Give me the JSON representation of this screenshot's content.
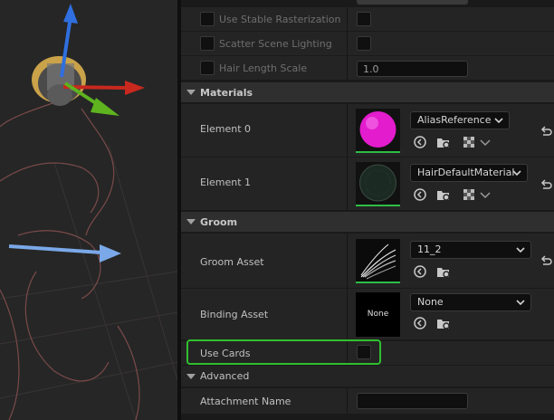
{
  "rendering": {
    "use_stable_rasterization": "Use Stable Rasterization",
    "scatter_scene_lighting": "Scatter Scene Lighting",
    "hair_length_scale": "Hair Length Scale",
    "hair_length_scale_value": "1.0"
  },
  "materials": {
    "title": "Materials",
    "elements": [
      {
        "label": "Element 0",
        "value": "AliasReference",
        "thumb_color": "#e31ccd"
      },
      {
        "label": "Element 1",
        "value": "HairDefaultMaterial",
        "thumb_color": "#1c2a24"
      }
    ]
  },
  "groom": {
    "title": "Groom",
    "groom_asset_label": "Groom Asset",
    "groom_asset_value": "11_2",
    "binding_asset_label": "Binding Asset",
    "binding_asset_value": "None",
    "binding_thumb_text": "None",
    "use_cards_label": "Use Cards"
  },
  "advanced": {
    "title": "Advanced",
    "attachment_name_label": "Attachment Name",
    "attachment_name_value": ""
  },
  "colors": {
    "accent_green": "#2fbf2f",
    "material0": "#e31ccd"
  }
}
